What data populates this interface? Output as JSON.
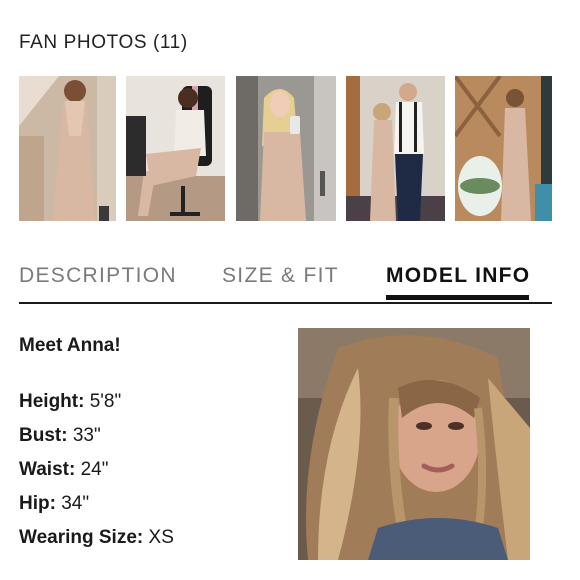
{
  "fan_photos": {
    "title": "FAN PHOTOS (11)",
    "thumbnails": [
      {
        "icon": "photo-thumbnail"
      },
      {
        "icon": "photo-thumbnail"
      },
      {
        "icon": "photo-thumbnail"
      },
      {
        "icon": "photo-thumbnail"
      },
      {
        "icon": "photo-thumbnail"
      }
    ]
  },
  "tabs": {
    "items": [
      {
        "label": "DESCRIPTION",
        "active": false
      },
      {
        "label": "SIZE & FIT",
        "active": false
      },
      {
        "label": "MODEL INFO",
        "active": true
      }
    ]
  },
  "model_info": {
    "intro": "Meet Anna!",
    "stats": [
      {
        "label": "Height:",
        "value": "5'8\""
      },
      {
        "label": "Bust:",
        "value": "33\""
      },
      {
        "label": "Waist:",
        "value": "24\""
      },
      {
        "label": "Hip:",
        "value": "34\""
      },
      {
        "label": "Wearing Size:",
        "value": "XS"
      }
    ]
  },
  "colors": {
    "text": "#1a1a1a",
    "tab_inactive": "#7a7a7a",
    "underline": "#111111",
    "dress": "#d7b7a3"
  }
}
